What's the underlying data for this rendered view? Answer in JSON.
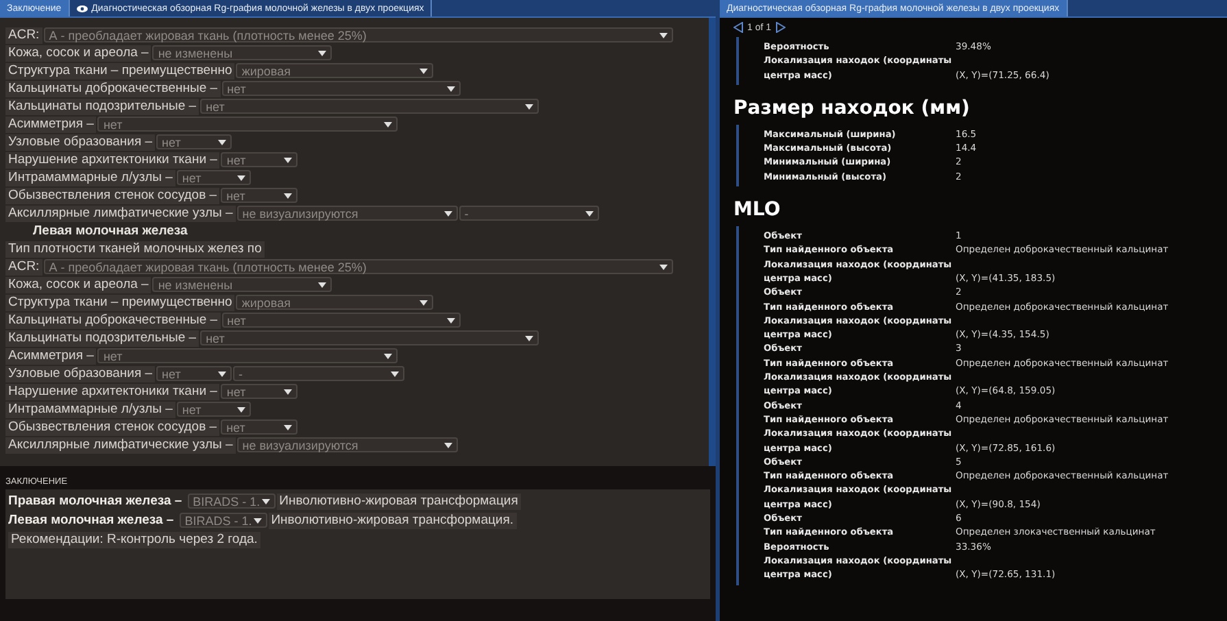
{
  "left_tabs": [
    {
      "label": "Заключение",
      "selected": true,
      "icon": false
    },
    {
      "label": "Диагностическая обзорная Rg-графия молочной железы в двух проекциях",
      "selected": false,
      "icon": true
    }
  ],
  "form": {
    "sections": [
      {
        "rows": [
          {
            "label": "ACR:",
            "dropdowns": [
              "А - преобладает жировая ткань (плотность менее 25%)"
            ]
          },
          {
            "label": "Кожа, сосок и ареола –",
            "dropdowns": [
              "не изменены"
            ]
          },
          {
            "label": "Структура ткани – преимущественно",
            "dropdowns": [
              "жировая"
            ]
          },
          {
            "label": "Кальцинаты доброкачественные –",
            "dropdowns": [
              "нет"
            ]
          },
          {
            "label": "Кальцинаты подозрительные –",
            "dropdowns": [
              "нет"
            ]
          },
          {
            "label": "Асимметрия –",
            "dropdowns": [
              "нет"
            ]
          },
          {
            "label": "Узловые образования –",
            "dropdowns": [
              "нет"
            ]
          },
          {
            "label": "Нарушение архитектоники ткани –",
            "dropdowns": [
              "нет"
            ]
          },
          {
            "label": "Интрамаммарные л/узлы –",
            "dropdowns": [
              "нет"
            ]
          },
          {
            "label": "Обызвествления стенок сосудов –",
            "dropdowns": [
              "нет"
            ]
          },
          {
            "label": "Аксиллярные лимфатические узлы –",
            "dropdowns": [
              "не визуализируются",
              "-"
            ]
          }
        ]
      },
      {
        "heading": "Левая молочная железа",
        "intro": "Тип плотности тканей молочных желез по",
        "rows": [
          {
            "label": "ACR:",
            "dropdowns": [
              "А - преобладает жировая ткань (плотность менее 25%)"
            ]
          },
          {
            "label": "Кожа, сосок и ареола –",
            "dropdowns": [
              "не изменены"
            ]
          },
          {
            "label": "Структура ткани – преимущественно",
            "dropdowns": [
              "жировая"
            ]
          },
          {
            "label": "Кальцинаты доброкачественные –",
            "dropdowns": [
              "нет"
            ]
          },
          {
            "label": "Кальцинаты подозрительные –",
            "dropdowns": [
              "нет"
            ]
          },
          {
            "label": "Асимметрия –",
            "dropdowns": [
              "нет"
            ]
          },
          {
            "label": "Узловые образования –",
            "dropdowns": [
              "нет",
              "-"
            ]
          },
          {
            "label": "Нарушение архитектоники ткани –",
            "dropdowns": [
              "нет"
            ]
          },
          {
            "label": "Интрамаммарные л/узлы –",
            "dropdowns": [
              "нет"
            ]
          },
          {
            "label": "Обызвествления стенок сосудов –",
            "dropdowns": [
              "нет"
            ]
          },
          {
            "label": "Аксиллярные лимфатические узлы –",
            "dropdowns": [
              "не визуализируются"
            ]
          }
        ]
      }
    ]
  },
  "conclusion": {
    "label": "ЗАКЛЮЧЕНИЕ",
    "lines": [
      {
        "kind": "birads",
        "side": "Правая молочная железа –",
        "dropdown": "BIRADS - 1.",
        "text": "Инволютивно-жировая трансформация"
      },
      {
        "kind": "birads",
        "side": "Левая  молочная железа –",
        "dropdown": "BIRADS - 1.",
        "text": "Инволютивно-жировая трансформация."
      },
      {
        "kind": "text",
        "text": "Рекомендации: R-контроль через 2 года."
      }
    ]
  },
  "report": {
    "tab": {
      "label": "Диагностическая обзорная Rg-графия молочной железы в двух проекциях",
      "selected": true
    },
    "pager": "1 of 1",
    "groups": [
      {
        "rows": [
          [
            "Вероятность",
            "39.48%"
          ],
          [
            "Локализация находок (координаты центра масс)",
            "(X, Y)=(71.25, 66.4)"
          ]
        ]
      },
      {
        "heading": "Размер находок (мм)",
        "rows": [
          [
            "Максимальный (ширина)",
            "16.5"
          ],
          [
            "Максимальный (высота)",
            "14.4"
          ],
          [
            "Минимальный (ширина)",
            "2"
          ],
          [
            "Минимальный (высота)",
            "2"
          ]
        ]
      },
      {
        "heading": "MLO",
        "rows": [
          [
            "Объект",
            "1"
          ],
          [
            "Тип найденного объекта",
            "Определен доброкачественный кальцинат"
          ],
          [
            "Локализация находок (координаты центра масс)",
            "(X, Y)=(41.35, 183.5)"
          ],
          [
            "Объект",
            "2"
          ],
          [
            "Тип найденного объекта",
            "Определен доброкачественный кальцинат"
          ],
          [
            "Локализация находок (координаты центра масс)",
            "(X, Y)=(4.35, 154.5)"
          ],
          [
            "Объект",
            "3"
          ],
          [
            "Тип найденного объекта",
            "Определен доброкачественный кальцинат"
          ],
          [
            "Локализация находок (координаты центра масс)",
            "(X, Y)=(64.8, 159.05)"
          ],
          [
            "Объект",
            "4"
          ],
          [
            "Тип найденного объекта",
            "Определен доброкачественный кальцинат"
          ],
          [
            "Локализация находок (координаты центра масс)",
            "(X, Y)=(72.85, 161.6)"
          ],
          [
            "Объект",
            "5"
          ],
          [
            "Тип найденного объекта",
            "Определен доброкачественный кальцинат"
          ],
          [
            "Локализация находок (координаты центра масс)",
            "(X, Y)=(90.8, 154)"
          ],
          [
            "Объект",
            "6"
          ],
          [
            "Тип найденного объекта",
            "Определен злокачественный кальцинат"
          ],
          [
            "Вероятность",
            "33.36%"
          ],
          [
            "Локализация находок (координаты центра масс)",
            "(X, Y)=(72.65, 131.1)"
          ]
        ]
      }
    ]
  }
}
